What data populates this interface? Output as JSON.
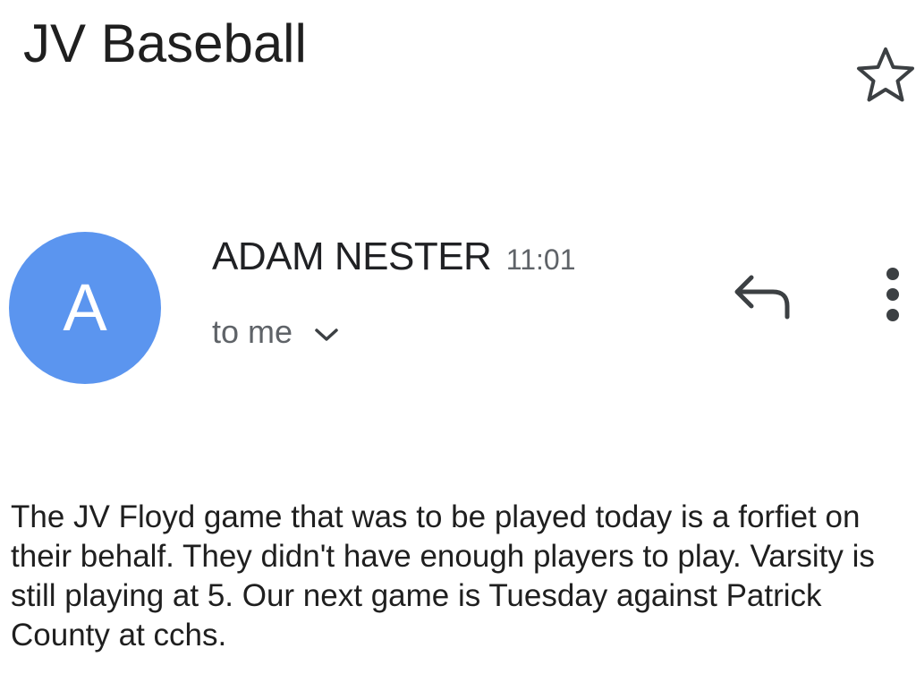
{
  "email": {
    "subject": "JV Baseball",
    "sender": {
      "avatar_letter": "A",
      "name": "ADAM NESTER",
      "time": "11:01",
      "recipient": "to me"
    },
    "body": "The JV Floyd game that was to be played today is a forfiet on their behalf. They didn't have enough players to play. Varsity is still playing at 5. Our next game is Tuesday against Patrick County at cchs."
  },
  "icons": {
    "star": "star-outline-icon",
    "reply": "reply-icon",
    "more": "more-vert-icon",
    "expand": "chevron-down-icon"
  },
  "colors": {
    "avatar_bg": "#5b95ef",
    "text_primary": "#202124",
    "text_secondary": "#5f6368"
  }
}
